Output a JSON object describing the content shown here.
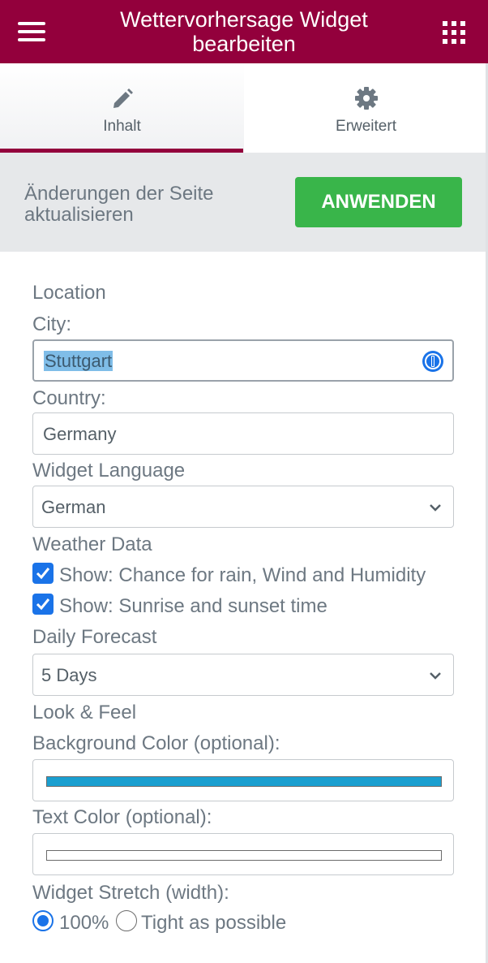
{
  "header": {
    "title": "Wettervorhersage Widget bearbeiten",
    "menu_icon": "hamburger-menu-icon",
    "apps_icon": "grid-apps-icon",
    "color": "#93003c"
  },
  "tabs": [
    {
      "label": "Inhalt",
      "icon": "pencil-icon",
      "active": true
    },
    {
      "label": "Erweitert",
      "icon": "gear-icon",
      "active": false
    }
  ],
  "apply_bar": {
    "message": "Änderungen der Seite aktualisieren",
    "button_label": "ANWENDEN",
    "button_color": "#39b54a"
  },
  "form": {
    "location_heading": "Location",
    "city": {
      "label": "City:",
      "value": "Stuttgart"
    },
    "country": {
      "label": "Country:",
      "value": "Germany"
    },
    "language": {
      "label": "Widget Language",
      "value": "German"
    },
    "weather_heading": "Weather Data",
    "checkbox_rain": {
      "label": "Show: Chance for rain, Wind and Humidity",
      "checked": true
    },
    "checkbox_sun": {
      "label": "Show: Sunrise and sunset time",
      "checked": true
    },
    "forecast": {
      "label": "Daily Forecast",
      "value": "5 Days"
    },
    "look_heading": "Look & Feel",
    "bg_color": {
      "label": "Background Color (optional):",
      "value": "#1a9fd0"
    },
    "text_color": {
      "label": "Text Color (optional):",
      "value": "#ffffff"
    },
    "stretch": {
      "label": "Widget Stretch (width):",
      "options": [
        "100%",
        "Tight as possible"
      ],
      "selected": "100%"
    }
  }
}
